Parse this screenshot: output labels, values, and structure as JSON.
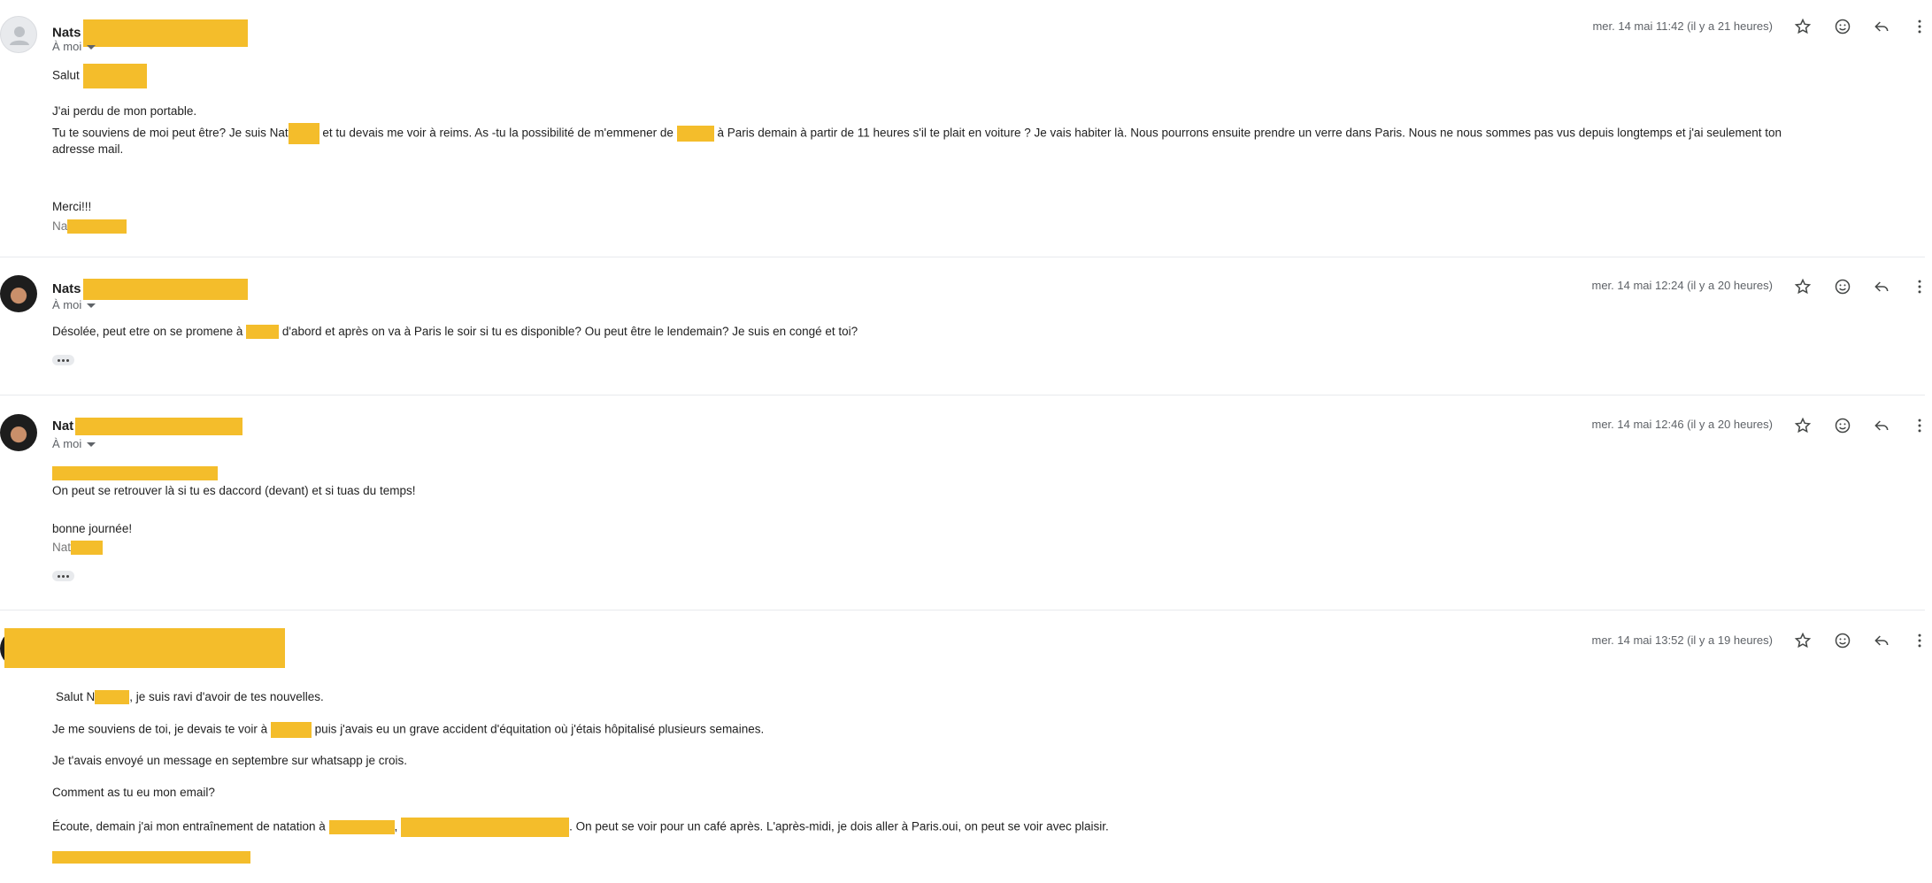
{
  "messages": [
    {
      "sender": "Nats",
      "to": "À moi",
      "date": "mer. 14 mai 11:42 (il y a 21 heures)",
      "greeting": "Salut",
      "line1": "J'ai perdu de mon portable.",
      "line2a": "Tu te souviens de moi peut être? Je suis Nat",
      "line2b": "et tu devais me voir à reims. As -tu la possibilité de m'emmener de",
      "line2c": "à Paris demain à partir de 11 heures s'il te plait en voiture ? Je vais habiter là. Nous pourrons ensuite prendre un verre dans Paris. Nous ne nous sommes pas vus depuis longtemps et j'ai seulement ton",
      "line3": "adresse mail.",
      "thanks": "Merci!!!",
      "signature": "Na"
    },
    {
      "sender": "Nats",
      "to": "À moi",
      "date": "mer. 14 mai 12:24 (il y a 20 heures)",
      "line1a": "Désolée, peut etre on se promene à",
      "line1b": "d'abord et après on va à Paris le soir si tu es disponible? Ou peut être le lendemain? Je suis en congé et toi?"
    },
    {
      "sender": "Nat",
      "to": "À moi",
      "date": "mer. 14 mai 12:46 (il y a 20 heures)",
      "line1": "On peut se retrouver là si tu es daccord (devant) et si tuas du temps!",
      "line2": "bonne journée!",
      "signature": "Nat"
    },
    {
      "date": "mer. 14 mai 13:52 (il y a 19 heures)",
      "line1a": "Salut N",
      "line1b": ", je suis ravi d'avoir de tes nouvelles.",
      "line2a": "Je me souviens de toi, je devais te voir à",
      "line2b": "puis j'avais eu un grave accident d'équitation où j'étais hôpitalisé plusieurs semaines.",
      "line3": "Je t'avais envoyé un message en septembre sur whatsapp je crois.",
      "line4": "Comment as tu eu mon email?",
      "line5a": "Écoute, demain j'ai mon entraînement de natation à",
      "line5b": ",",
      "line5c": ". On peut se voir pour un café après. L'après-midi, je dois aller à Paris.oui, on peut se voir avec plaisir."
    }
  ],
  "icons": {
    "star": "star-icon",
    "emoji": "emoji-icon",
    "reply": "reply-icon",
    "more": "more-vert-icon",
    "caret": "chevron-down-icon",
    "ellipsis": "show-trimmed-content-icon"
  },
  "colors": {
    "redaction": "#f4bd2b",
    "meta_text": "#5f6368",
    "divider": "#e8eaed"
  }
}
